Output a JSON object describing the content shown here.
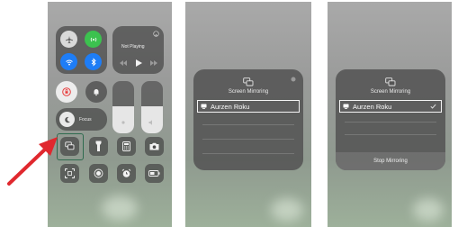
{
  "control_center": {
    "now_playing": "Not Playing",
    "focus_label": "Focus"
  },
  "mirroring_sheet": {
    "title": "Screen Mirroring",
    "device_name": "Aurzen Roku",
    "stop_label": "Stop Mirroring"
  },
  "colors": {
    "airplane": "#d9d9d9",
    "cellular": "#3cc24f",
    "wifi_bluetooth": "#1e7df6",
    "orientation_lock": "#e83b3b",
    "highlight_box": "#2f6b4f",
    "arrow": "#e0282e"
  },
  "icons": [
    "airplane-icon",
    "cellular-icon",
    "wifi-icon",
    "bluetooth-icon",
    "orientation-lock-icon",
    "bell-icon",
    "moon-icon",
    "screen-mirroring-icon",
    "flashlight-icon",
    "calculator-icon",
    "camera-icon",
    "qr-code-icon",
    "record-icon",
    "alarm-icon",
    "battery-icon",
    "checkmark-icon"
  ]
}
